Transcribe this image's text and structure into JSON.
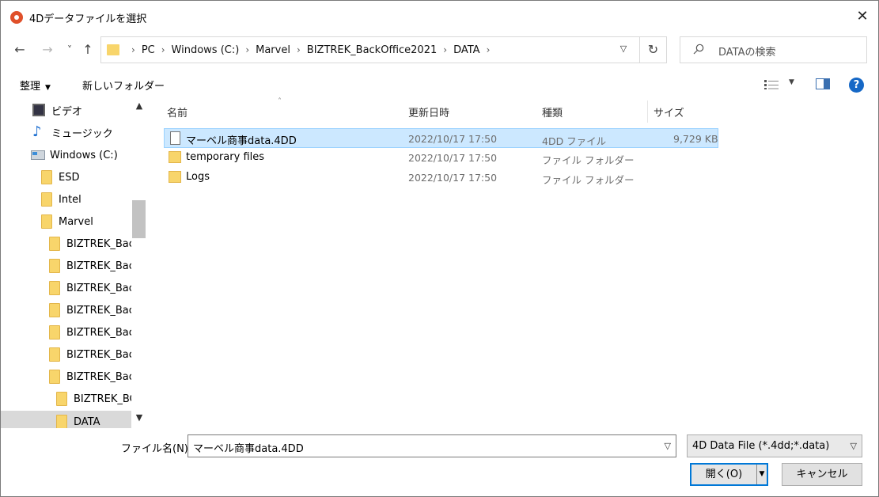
{
  "window": {
    "title": "4Dデータファイルを選択",
    "close": "✕"
  },
  "nav": {
    "back": "←",
    "forward": "→",
    "recent": "˅",
    "up": "↑",
    "breadcrumbs": [
      "PC",
      "Windows (C:)",
      "Marvel",
      "BIZTREK_BackOffice2021",
      "DATA"
    ],
    "refresh": "↻",
    "search_placeholder": "DATAの検索"
  },
  "toolbar": {
    "organize": "整理",
    "new_folder": "新しいフォルダー"
  },
  "tree": [
    {
      "label": "ビデオ",
      "icon": "video-icon"
    },
    {
      "label": "ミュージック",
      "icon": "music-icon"
    },
    {
      "label": "Windows (C:)",
      "icon": "drive-icon"
    },
    {
      "label": "ESD",
      "icon": "folder-icon"
    },
    {
      "label": "Intel",
      "icon": "folder-icon"
    },
    {
      "label": "Marvel",
      "icon": "folder-icon"
    },
    {
      "label": "BIZTREK_Back",
      "icon": "folder-icon"
    },
    {
      "label": "BIZTREK_Back",
      "icon": "folder-icon"
    },
    {
      "label": "BIZTREK_Back",
      "icon": "folder-icon"
    },
    {
      "label": "BIZTREK_Back",
      "icon": "folder-icon"
    },
    {
      "label": "BIZTREK_Back",
      "icon": "folder-icon"
    },
    {
      "label": "BIZTREK_Back",
      "icon": "folder-icon"
    },
    {
      "label": "BIZTREK_Back",
      "icon": "folder-icon"
    },
    {
      "label": "BIZTREK_BC",
      "icon": "folder-icon"
    },
    {
      "label": "DATA",
      "icon": "folder-icon"
    }
  ],
  "columns": {
    "name": "名前",
    "modified": "更新日時",
    "type": "種類",
    "size": "サイズ"
  },
  "files": [
    {
      "name": "マーベル商事data.4DD",
      "modified": "2022/10/17 17:50",
      "type": "4DD ファイル",
      "size": "9,729 KB"
    },
    {
      "name": "temporary files",
      "modified": "2022/10/17 17:50",
      "type": "ファイル フォルダー",
      "size": ""
    },
    {
      "name": "Logs",
      "modified": "2022/10/17 17:50",
      "type": "ファイル フォルダー",
      "size": ""
    }
  ],
  "bottom": {
    "filename_label": "ファイル名(N):",
    "filename_value": "マーベル商事data.4DD",
    "filetype_value": "4D Data File (*.4dd;*.data)",
    "open_label": "開く(O)",
    "cancel_label": "キャンセル"
  }
}
